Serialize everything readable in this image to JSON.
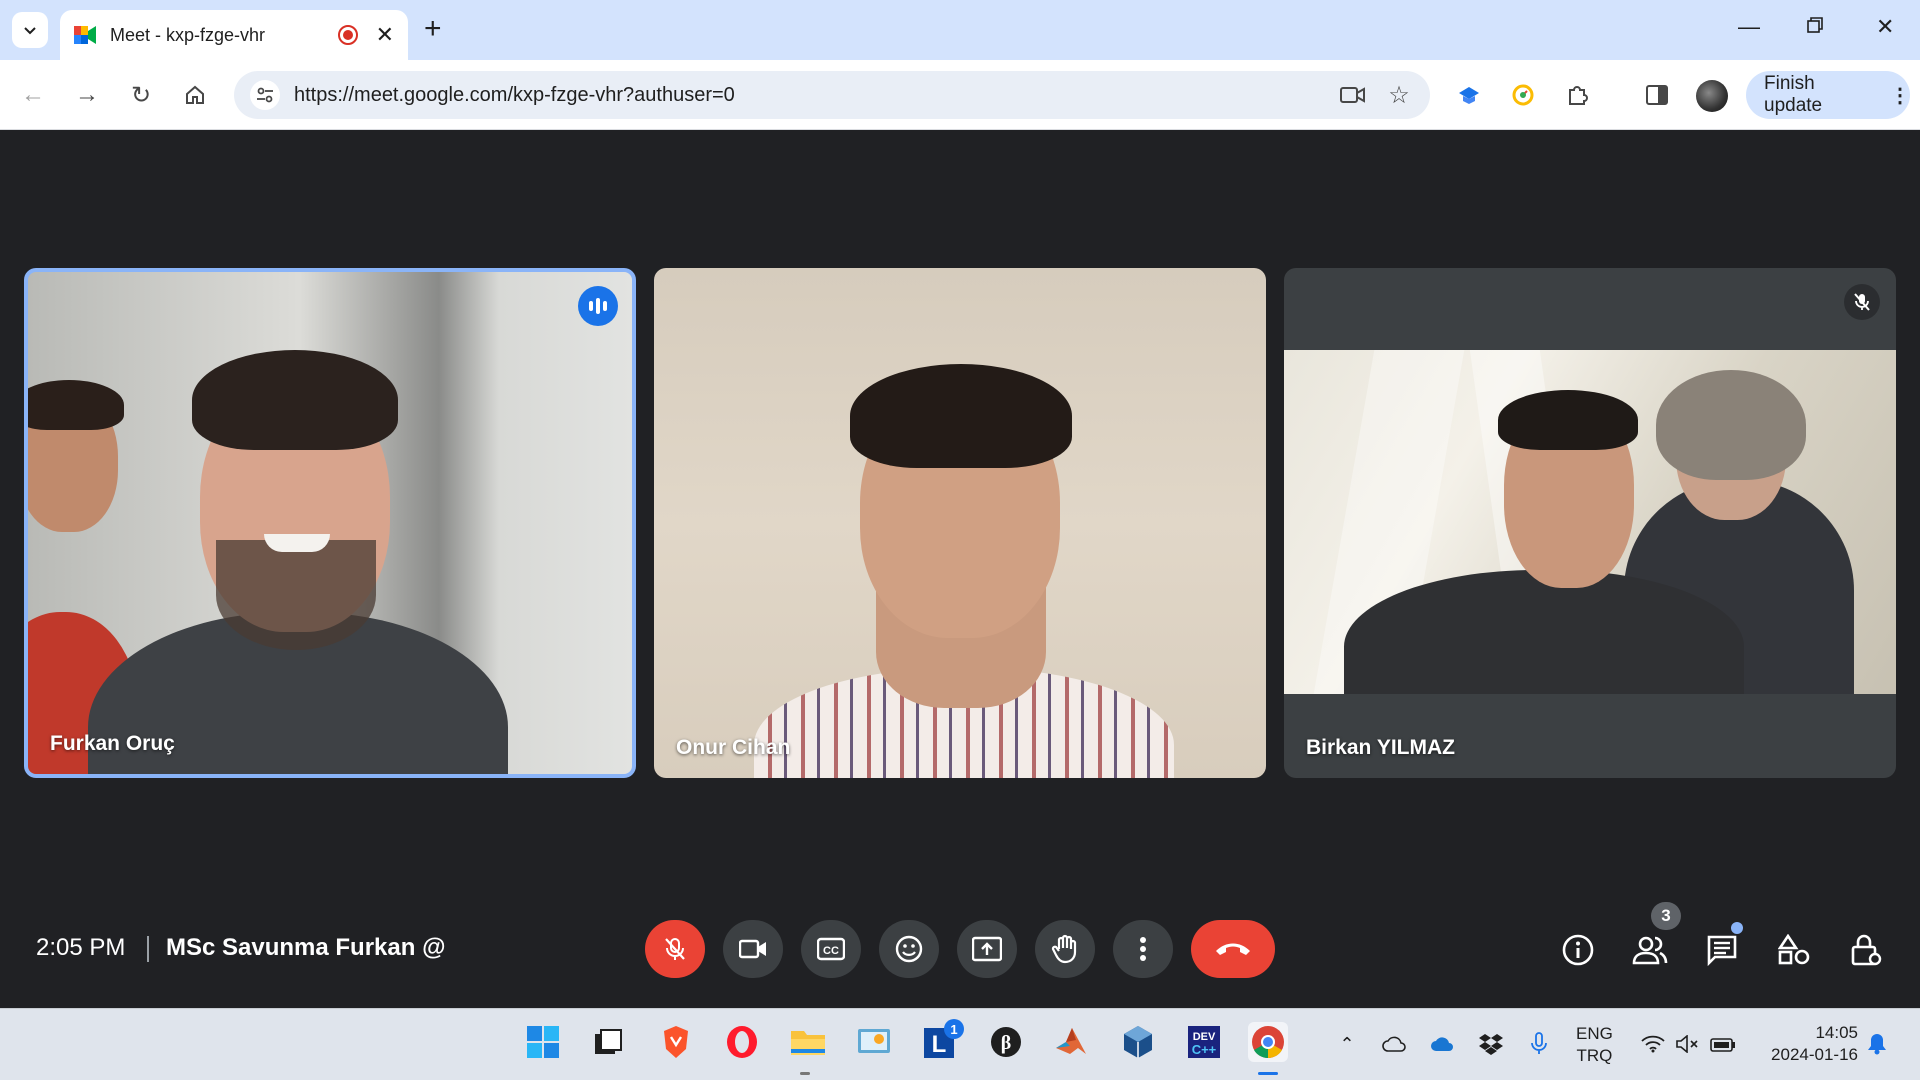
{
  "browser": {
    "tab_title": "Meet - kxp-fzge-vhr",
    "url": "https://meet.google.com/kxp-fzge-vhr?authuser=0",
    "finish_update_label": "Finish update"
  },
  "participants": [
    {
      "name": "Furkan Oruç",
      "speaking": true,
      "muted": false
    },
    {
      "name": "Onur Cihan",
      "speaking": false,
      "muted": false
    },
    {
      "name": "Birkan YILMAZ",
      "speaking": false,
      "muted": true
    }
  ],
  "bottom_bar": {
    "time": "2:05 PM",
    "meeting_name": "MSc Savunma Furkan @",
    "participant_count": "3",
    "controls": [
      "mic-off-icon",
      "camera-icon",
      "captions-icon",
      "emoji-icon",
      "present-icon",
      "raise-hand-icon",
      "more-options-icon",
      "end-call-icon"
    ],
    "right_controls": [
      "info-icon",
      "people-icon",
      "chat-icon",
      "activities-icon",
      "host-controls-icon"
    ]
  },
  "taskbar": {
    "app_badge": "1",
    "lang_line1": "ENG",
    "lang_line2": "TRQ",
    "time": "14:05",
    "date": "2024-01-16"
  },
  "colors": {
    "meet_bg": "#202124",
    "active_speaker_border": "#8ab4f8",
    "mute_red": "#ea4335",
    "control_grey": "#3c4043"
  }
}
